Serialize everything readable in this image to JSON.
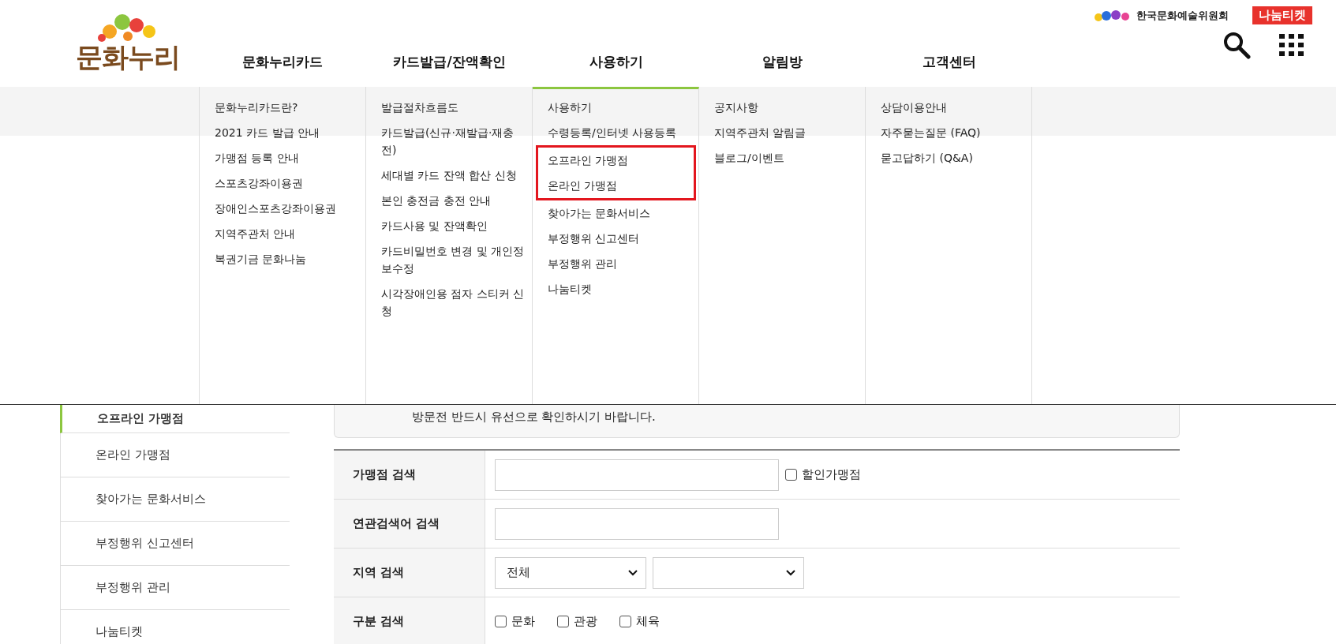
{
  "header": {
    "logo": "문화누리",
    "org_name": "한국문화예술위원회",
    "ticket_badge": "나눔티켓"
  },
  "nav": [
    {
      "label": "문화누리카드",
      "selected": false,
      "items": [
        {
          "label": "문화누리카드란?",
          "boxed": false
        },
        {
          "label": "2021 카드 발급 안내",
          "boxed": false
        },
        {
          "label": "가맹점 등록 안내",
          "boxed": false
        },
        {
          "label": "스포츠강좌이용권",
          "boxed": false
        },
        {
          "label": "장애인스포츠강좌이용권",
          "boxed": false
        },
        {
          "label": "지역주관처 안내",
          "boxed": false
        },
        {
          "label": "복권기금 문화나눔",
          "boxed": false
        }
      ]
    },
    {
      "label": "카드발급/잔액확인",
      "selected": false,
      "items": [
        {
          "label": "발급절차흐름도",
          "boxed": false
        },
        {
          "label": "카드발급(신규·재발급·재충전)",
          "boxed": false
        },
        {
          "label": "세대별 카드 잔액 합산 신청",
          "boxed": false
        },
        {
          "label": "본인 충전금 충전 안내",
          "boxed": false
        },
        {
          "label": "카드사용 및 잔액확인",
          "boxed": false
        },
        {
          "label": "카드비밀번호 변경 및 개인정보수정",
          "boxed": false
        },
        {
          "label": "시각장애인용 점자 스티커 신청",
          "boxed": false
        }
      ]
    },
    {
      "label": "사용하기",
      "selected": true,
      "items": [
        {
          "label": "사용하기",
          "boxed": false
        },
        {
          "label": "수령등록/인터넷 사용등록",
          "boxed": false
        },
        {
          "label": "오프라인 가맹점",
          "boxed": true
        },
        {
          "label": "온라인 가맹점",
          "boxed": true
        },
        {
          "label": "찾아가는 문화서비스",
          "boxed": false
        },
        {
          "label": "부정행위 신고센터",
          "boxed": false
        },
        {
          "label": "부정행위 관리",
          "boxed": false
        },
        {
          "label": "나눔티켓",
          "boxed": false
        }
      ]
    },
    {
      "label": "알림방",
      "selected": false,
      "items": [
        {
          "label": "공지사항",
          "boxed": false
        },
        {
          "label": "지역주관처 알림글",
          "boxed": false
        },
        {
          "label": "블로그/이벤트",
          "boxed": false
        }
      ]
    },
    {
      "label": "고객센터",
      "selected": false,
      "items": [
        {
          "label": "상담이용안내",
          "boxed": false
        },
        {
          "label": "자주묻는질문 (FAQ)",
          "boxed": false
        },
        {
          "label": "묻고답하기 (Q&A)",
          "boxed": false
        }
      ]
    }
  ],
  "sidebar": {
    "items": [
      {
        "label": "오프라인 가맹점",
        "selected": true
      },
      {
        "label": "온라인 가맹점",
        "selected": false
      },
      {
        "label": "찾아가는 문화서비스",
        "selected": false
      },
      {
        "label": "부정행위 신고센터",
        "selected": false
      },
      {
        "label": "부정행위 관리",
        "selected": false
      },
      {
        "label": "나눔티켓",
        "selected": false
      }
    ]
  },
  "notice": {
    "text": "방문전 반드시 유선으로 확인하시기 바랍니다."
  },
  "search_form": {
    "rows": [
      {
        "kind": "text",
        "label": "가맹점 검색",
        "checkbox": {
          "label": "할인가맹점",
          "checked": false
        }
      },
      {
        "kind": "text",
        "label": "연관검색어 검색"
      },
      {
        "kind": "selects",
        "label": "지역 검색",
        "selects": [
          "전체"
        ]
      },
      {
        "kind": "checkboxes",
        "label": "구분 검색",
        "options": [
          {
            "label": "문화",
            "checked": false
          },
          {
            "label": "관광",
            "checked": false
          },
          {
            "label": "체육",
            "checked": false
          }
        ]
      }
    ]
  }
}
